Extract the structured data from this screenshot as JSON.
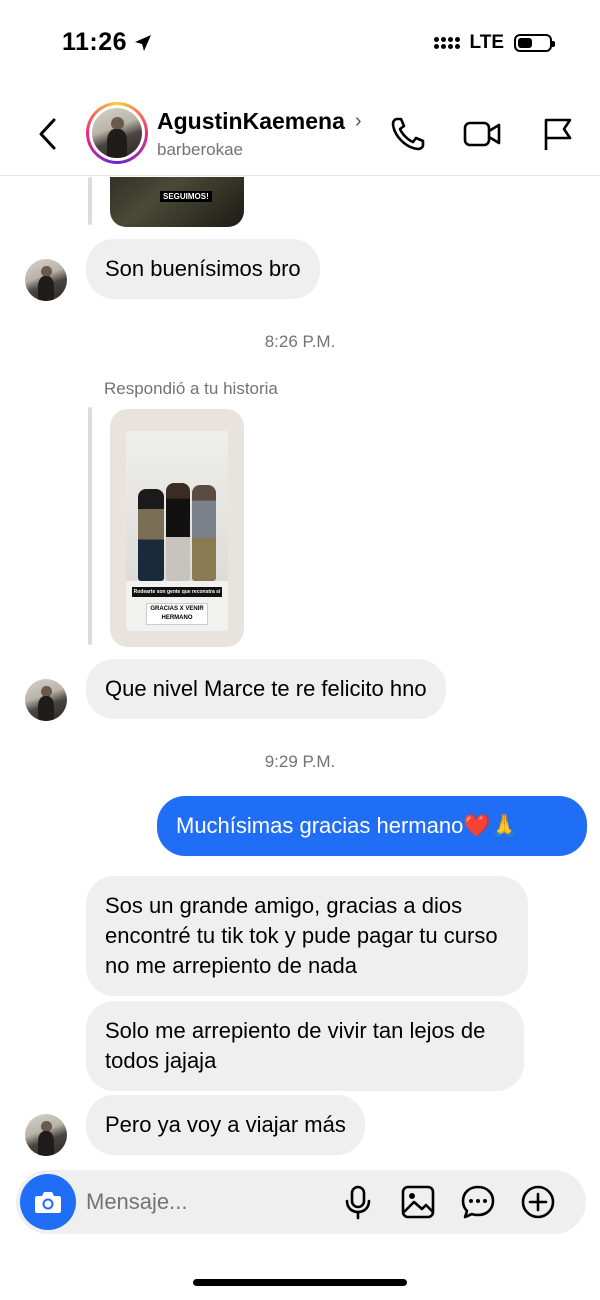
{
  "status_bar": {
    "time": "11:26",
    "network": "LTE",
    "battery_level": 0.45
  },
  "header": {
    "contact_name": "AgustinKaemena",
    "contact_handle": "barberokae",
    "icons": [
      "back-icon",
      "phone-icon",
      "video-icon",
      "flag-icon"
    ]
  },
  "messages": {
    "story_top_tag": "SEGUIMOS!",
    "msg1": "Son buenísimos bro",
    "time1": "8:26 P.M.",
    "reply_note": "Respondió a tu historia",
    "story_caption": "Rodearte son gente que reconstra sí !!!!!",
    "story_thanks": "GRACIAS X VENIR HERMANO",
    "msg2": "Que nivel Marce te re felicito hno",
    "time2": "9:29 P.M.",
    "msg_out": "Muchísimas gracias hermano❤️🙏",
    "msg3": "Sos un grande amigo, gracias a dios encontré tu tik tok y pude pagar tu curso no me arrepiento de nada",
    "msg4": "Solo me arrepiento de vivir tan lejos de todos jajaja",
    "msg5": "Pero ya voy a viajar más"
  },
  "composer": {
    "placeholder": "Mensaje...",
    "icons": [
      "camera-icon",
      "microphone-icon",
      "gallery-icon",
      "sticker-icon",
      "plus-icon"
    ]
  },
  "colors": {
    "accent_blue": "#1f6ef5",
    "incoming_bubble": "#efefef",
    "muted_text": "#737373"
  }
}
